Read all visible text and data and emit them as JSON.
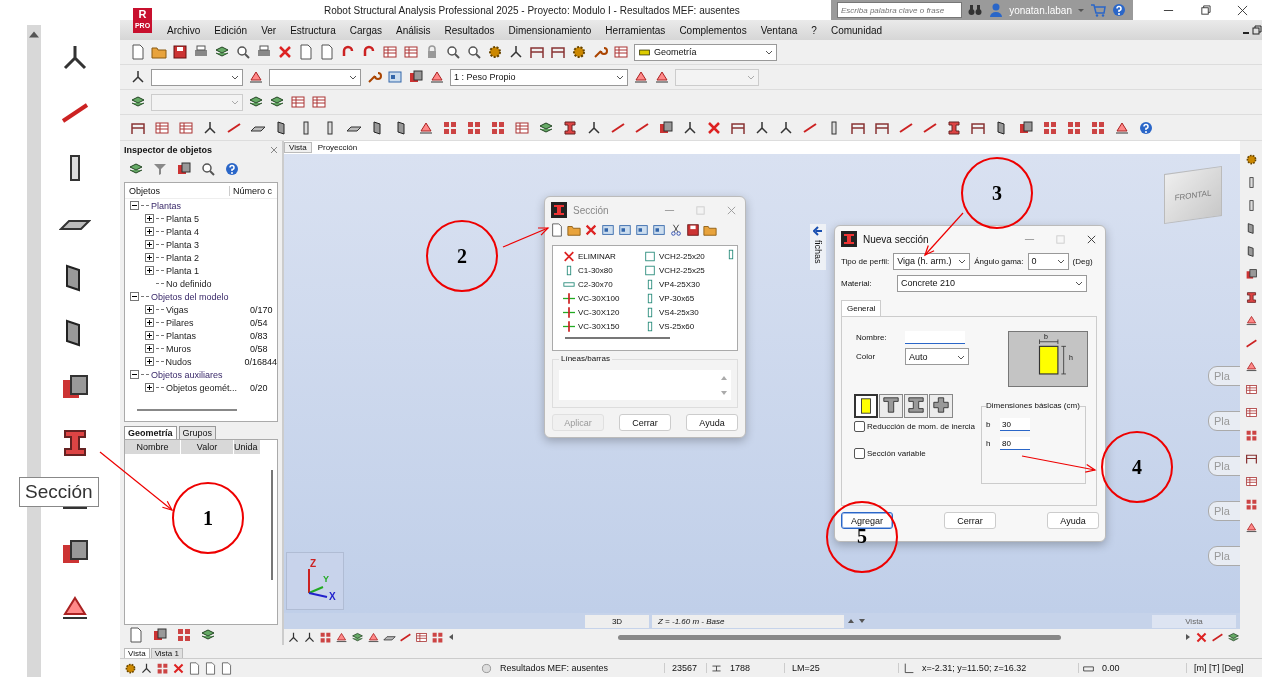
{
  "window": {
    "title": "Robot Structural Analysis Professional 2025 - Proyecto: Modulo I - Resultados MEF: ausentes",
    "logo": {
      "letter": "R",
      "edition": "PRO"
    },
    "search": {
      "placeholder": "Escriba palabra clave o frase"
    },
    "user": "yonatan.laban"
  },
  "menu": [
    "Archivo",
    "Edición",
    "Ver",
    "Estructura",
    "Cargas",
    "Análisis",
    "Resultados",
    "Dimensionamiento",
    "Herramientas",
    "Complementos",
    "Ventana",
    "?",
    "Comunidad"
  ],
  "toolbar": {
    "view_select": "Geometría",
    "load_case": "1 : Peso Propio"
  },
  "ribbon": {
    "tooltip": "Sección"
  },
  "inspector": {
    "title": "Inspector de objetos",
    "columns": [
      "Objetos",
      "Número c"
    ],
    "tree": [
      {
        "label": "Plantas",
        "kind": "group",
        "expanded": true,
        "children": [
          {
            "label": "Planta 5",
            "kind": "node",
            "expanded": false
          },
          {
            "label": "Planta 4",
            "kind": "node",
            "expanded": false
          },
          {
            "label": "Planta 3",
            "kind": "node",
            "expanded": false
          },
          {
            "label": "Planta 2",
            "kind": "node",
            "expanded": false
          },
          {
            "label": "Planta 1",
            "kind": "node",
            "expanded": false
          },
          {
            "label": "No definido",
            "kind": "leaf"
          }
        ]
      },
      {
        "label": "Objetos del modelo",
        "kind": "group",
        "expanded": true,
        "children": [
          {
            "label": "Vigas",
            "count": "0/170",
            "kind": "node",
            "expanded": false
          },
          {
            "label": "Pilares",
            "count": "0/54",
            "kind": "node",
            "expanded": false
          },
          {
            "label": "Plantas",
            "count": "0/83",
            "kind": "node",
            "expanded": false
          },
          {
            "label": "Muros",
            "count": "0/58",
            "kind": "node",
            "expanded": false
          },
          {
            "label": "Nudos",
            "count": "0/16844",
            "kind": "node",
            "expanded": false
          }
        ]
      },
      {
        "label": "Objetos auxiliares",
        "kind": "group",
        "expanded": true,
        "children": [
          {
            "label": "Objetos geomét...",
            "count": "0/20",
            "kind": "node",
            "expanded": false
          }
        ]
      }
    ],
    "tabs": [
      {
        "label": "Geometría",
        "selected": true
      },
      {
        "label": "Grupos",
        "selected": false
      }
    ],
    "property_columns": [
      "Nombre",
      "Valor",
      "Unida"
    ]
  },
  "view_tabs": [
    {
      "label": "Vista",
      "selected": true
    },
    {
      "label": "Proyección",
      "selected": false
    }
  ],
  "section_dialog": {
    "title": "Sección",
    "sections": [
      {
        "name": "ELIMINAR",
        "kind": "delete"
      },
      {
        "name": "C1-30x80",
        "kind": "column"
      },
      {
        "name": "C2-30x70",
        "kind": "flat"
      },
      {
        "name": "VC-30X100",
        "kind": "special"
      },
      {
        "name": "VC-30X120",
        "kind": "special"
      },
      {
        "name": "VC-30X150",
        "kind": "special"
      },
      {
        "name": "VCH2-25x20",
        "kind": "square"
      },
      {
        "name": "VCH2-25x25",
        "kind": "square"
      },
      {
        "name": "VP4-25X30",
        "kind": "column"
      },
      {
        "name": "VP-30x65",
        "kind": "column"
      },
      {
        "name": "VS4-25x30",
        "kind": "column"
      },
      {
        "name": "VS-25x60",
        "kind": "column"
      }
    ],
    "group_label": "Líneas/barras",
    "buttons": [
      {
        "label": "Aplicar",
        "disabled": true
      },
      {
        "label": "Cerrar",
        "disabled": false
      },
      {
        "label": "Ayuda",
        "disabled": false
      }
    ]
  },
  "side_tab": "fichas",
  "view_cube": "FRONTAL",
  "ghost_buttons": [
    "Pla",
    "Pla",
    "Pla",
    "Pla",
    "Pla"
  ],
  "axes": {
    "x": "X",
    "y": "Y",
    "z": "Z"
  },
  "new_section_dialog": {
    "title": "Nueva sección",
    "profile_label": "Tipo de perfil:",
    "profile": "Viga (h. arm.)",
    "angle_label": "Ángulo gama:",
    "angle": "0",
    "angle_unit": "(Deg)",
    "material_label": "Material:",
    "material": "Concrete 210",
    "tab": "General",
    "name_label": "Nombre:",
    "color_label": "Color",
    "color_choice": "Auto",
    "preview_b": "b",
    "preview_h": "h",
    "shapes": [
      {
        "kind": "rect",
        "selected": true
      },
      {
        "kind": "tee",
        "selected": false
      },
      {
        "kind": "ibeam",
        "selected": false
      },
      {
        "kind": "cross",
        "selected": false
      }
    ],
    "checkboxes": [
      {
        "label": "Reducción de mom. de inercia",
        "checked": false
      },
      {
        "label": "Sección variable",
        "checked": false
      }
    ],
    "dims_title": "Dimensiones básicas (cm)",
    "dims": [
      {
        "label": "b",
        "value": "30"
      },
      {
        "label": "h",
        "value": "80"
      }
    ],
    "buttons": [
      {
        "label": "Agregar",
        "default": true
      },
      {
        "label": "Cerrar",
        "default": false
      },
      {
        "label": "Ayuda",
        "default": false
      }
    ]
  },
  "viewport_bar": {
    "mode": "3D",
    "level": "Z = -1.60 m - Base",
    "view": "Vista"
  },
  "bottom_tabs": [
    {
      "label": "Vista",
      "selected": true
    },
    {
      "label": "Vista 1",
      "selected": false
    }
  ],
  "status_bar": {
    "results": "Resultados MEF: ausentes",
    "nodes": "23567",
    "bars": "1788",
    "lm": "LM=25",
    "coords": "x=-2.31; y=11.50; z=16.32",
    "angle": "0.00",
    "units": "[m] [T] [Deg]"
  },
  "annotations": [
    {
      "label": "1"
    },
    {
      "label": "2"
    },
    {
      "label": "3"
    },
    {
      "label": "4"
    },
    {
      "label": "5"
    }
  ]
}
